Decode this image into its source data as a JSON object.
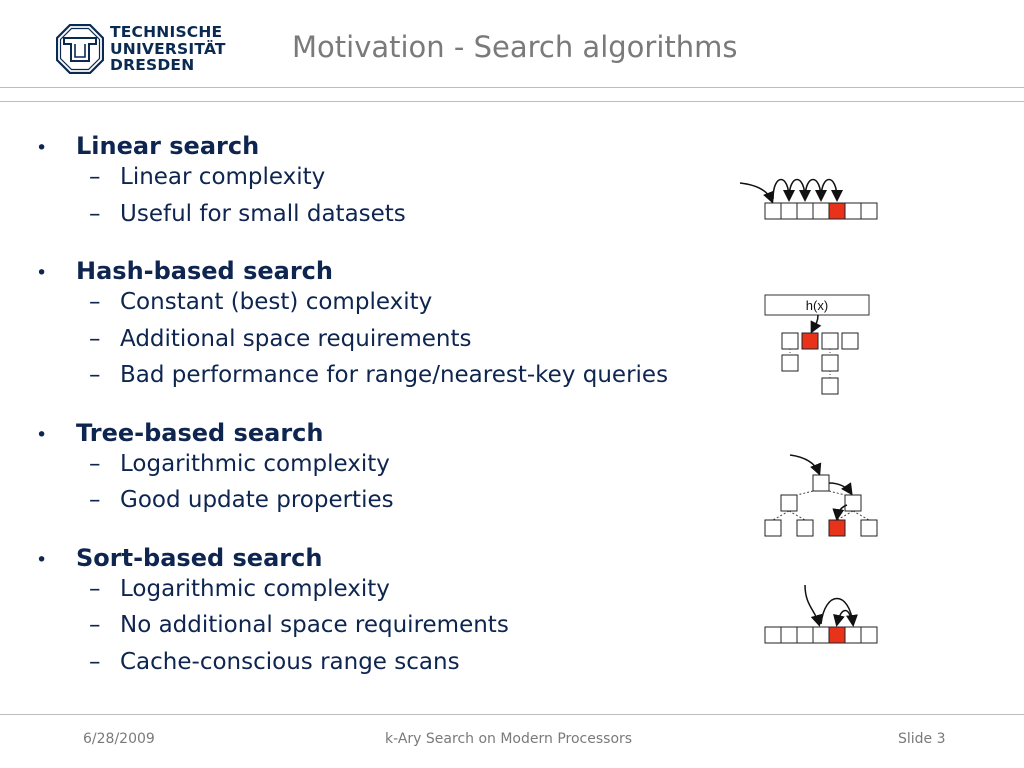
{
  "header": {
    "logo": {
      "icon": "tu-dresden-octagon-logo",
      "lines": [
        "TECHNISCHE",
        "UNIVERSITÄT",
        "DRESDEN"
      ]
    },
    "title": "Motivation - Search algorithms"
  },
  "sections": [
    {
      "heading": "Linear search",
      "items": [
        "Linear complexity",
        "Useful for small datasets"
      ],
      "diagram": "linear-search-diagram"
    },
    {
      "heading": "Hash-based search",
      "items": [
        "Constant (best) complexity",
        "Additional space requirements",
        "Bad performance for range/nearest-key queries"
      ],
      "diagram": "hash-search-diagram",
      "diagram_label": "h(x)"
    },
    {
      "heading": "Tree-based search",
      "items": [
        "Logarithmic complexity",
        "Good update properties"
      ],
      "diagram": "tree-search-diagram"
    },
    {
      "heading": "Sort-based search",
      "items": [
        "Logarithmic complexity",
        "No additional space requirements",
        "Cache-conscious range scans"
      ],
      "diagram": "sort-search-diagram"
    }
  ],
  "colors": {
    "title": "#7a7a7a",
    "text": "#0e2550",
    "highlight": "#e8321a",
    "logo": "#0a2a52"
  },
  "footer": {
    "date": "6/28/2009",
    "center": "k-Ary Search on Modern Processors",
    "slide": "Slide 3"
  }
}
